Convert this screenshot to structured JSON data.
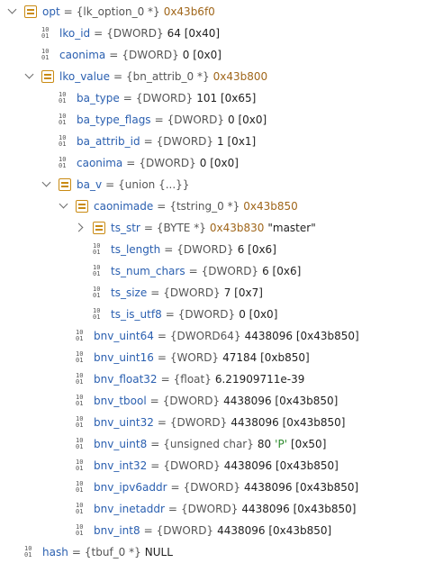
{
  "rows": [
    {
      "indent": 0,
      "expander": "down",
      "icon": "struct",
      "name": "opt",
      "type": "{lk_option_0 *}",
      "addr": "0x43b6f0"
    },
    {
      "indent": 1,
      "expander": "none",
      "icon": "bin",
      "name": "lko_id",
      "type": "{DWORD}",
      "value": "64 [0x40]"
    },
    {
      "indent": 1,
      "expander": "none",
      "icon": "bin",
      "name": "caonima",
      "type": "{DWORD}",
      "value": "0 [0x0]"
    },
    {
      "indent": 1,
      "expander": "down",
      "icon": "struct",
      "name": "lko_value",
      "type": "{bn_attrib_0 *}",
      "addr": "0x43b800"
    },
    {
      "indent": 2,
      "expander": "none",
      "icon": "bin",
      "name": "ba_type",
      "type": "{DWORD}",
      "value": "101 [0x65]"
    },
    {
      "indent": 2,
      "expander": "none",
      "icon": "bin",
      "name": "ba_type_flags",
      "type": "{DWORD}",
      "value": "0 [0x0]"
    },
    {
      "indent": 2,
      "expander": "none",
      "icon": "bin",
      "name": "ba_attrib_id",
      "type": "{DWORD}",
      "value": "1 [0x1]"
    },
    {
      "indent": 2,
      "expander": "none",
      "icon": "bin",
      "name": "caonima",
      "type": "{DWORD}",
      "value": "0 [0x0]"
    },
    {
      "indent": 2,
      "expander": "down",
      "icon": "struct",
      "name": "ba_v",
      "type": "{union {...}}"
    },
    {
      "indent": 3,
      "expander": "down",
      "icon": "struct",
      "name": "caonimade",
      "type": "{tstring_0 *}",
      "addr": "0x43b850"
    },
    {
      "indent": 4,
      "expander": "right",
      "icon": "struct",
      "name": "ts_str",
      "type": "{BYTE *}",
      "addr": "0x43b830",
      "str": "\"master\""
    },
    {
      "indent": 4,
      "expander": "none",
      "icon": "bin",
      "name": "ts_length",
      "type": "{DWORD}",
      "value": "6 [0x6]"
    },
    {
      "indent": 4,
      "expander": "none",
      "icon": "bin",
      "name": "ts_num_chars",
      "type": "{DWORD}",
      "value": "6 [0x6]"
    },
    {
      "indent": 4,
      "expander": "none",
      "icon": "bin",
      "name": "ts_size",
      "type": "{DWORD}",
      "value": "7 [0x7]"
    },
    {
      "indent": 4,
      "expander": "none",
      "icon": "bin",
      "name": "ts_is_utf8",
      "type": "{DWORD}",
      "value": "0 [0x0]"
    },
    {
      "indent": 3,
      "expander": "none",
      "icon": "bin",
      "name": "bnv_uint64",
      "type": "{DWORD64}",
      "value": "4438096 [0x43b850]"
    },
    {
      "indent": 3,
      "expander": "none",
      "icon": "bin",
      "name": "bnv_uint16",
      "type": "{WORD}",
      "value": "47184 [0xb850]"
    },
    {
      "indent": 3,
      "expander": "none",
      "icon": "bin",
      "name": "bnv_float32",
      "type": "{float}",
      "value": "6.21909711e-39"
    },
    {
      "indent": 3,
      "expander": "none",
      "icon": "bin",
      "name": "bnv_tbool",
      "type": "{DWORD}",
      "value": "4438096 [0x43b850]"
    },
    {
      "indent": 3,
      "expander": "none",
      "icon": "bin",
      "name": "bnv_uint32",
      "type": "{DWORD}",
      "value": "4438096 [0x43b850]"
    },
    {
      "indent": 3,
      "expander": "none",
      "icon": "bin",
      "name": "bnv_uint8",
      "type": "{unsigned char}",
      "value": "80",
      "chr": "'P'",
      "value2": "[0x50]"
    },
    {
      "indent": 3,
      "expander": "none",
      "icon": "bin",
      "name": "bnv_int32",
      "type": "{DWORD}",
      "value": "4438096 [0x43b850]"
    },
    {
      "indent": 3,
      "expander": "none",
      "icon": "bin",
      "name": "bnv_ipv6addr",
      "type": "{DWORD}",
      "value": "4438096 [0x43b850]"
    },
    {
      "indent": 3,
      "expander": "none",
      "icon": "bin",
      "name": "bnv_inetaddr",
      "type": "{DWORD}",
      "value": "4438096 [0x43b850]"
    },
    {
      "indent": 3,
      "expander": "none",
      "icon": "bin",
      "name": "bnv_int8",
      "type": "{DWORD}",
      "value": "4438096 [0x43b850]"
    },
    {
      "indent": 0,
      "expander": "none",
      "icon": "bin",
      "name": "hash",
      "type": "{tbuf_0 *}",
      "value": "NULL"
    }
  ],
  "icons": {
    "struct": "struct-icon",
    "bin": "binary-value-icon"
  },
  "bin_icon_glyph": {
    "top": "10",
    "bottom": "01"
  },
  "colors": {
    "name": "#2a5fb0",
    "address": "#a0661a",
    "char": "#2e8b2e",
    "struct_icon": "#c98a12"
  }
}
